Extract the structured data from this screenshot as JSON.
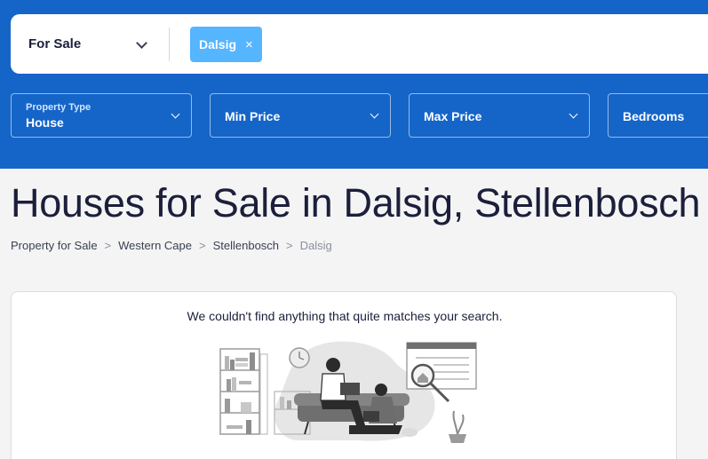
{
  "search": {
    "listing_type": "For Sale",
    "chips": [
      {
        "label": "Dalsig",
        "remove_icon": "×"
      }
    ]
  },
  "filters": {
    "property_type": {
      "label": "Property Type",
      "value": "House"
    },
    "min_price": {
      "label": "Min Price"
    },
    "max_price": {
      "label": "Max Price"
    },
    "bedrooms": {
      "label": "Bedrooms"
    }
  },
  "page": {
    "title": "Houses for Sale in Dalsig, Stellenbosch"
  },
  "breadcrumb": {
    "items": [
      "Property for Sale",
      "Western Cape",
      "Stellenbosch",
      "Dalsig"
    ],
    "separator": ">"
  },
  "empty_state": {
    "message": "We couldn't find anything that quite matches your search."
  },
  "colors": {
    "hero_blue": "#1565c8",
    "chip_blue": "#56b5ff",
    "text_dark": "#1b1f3b"
  }
}
